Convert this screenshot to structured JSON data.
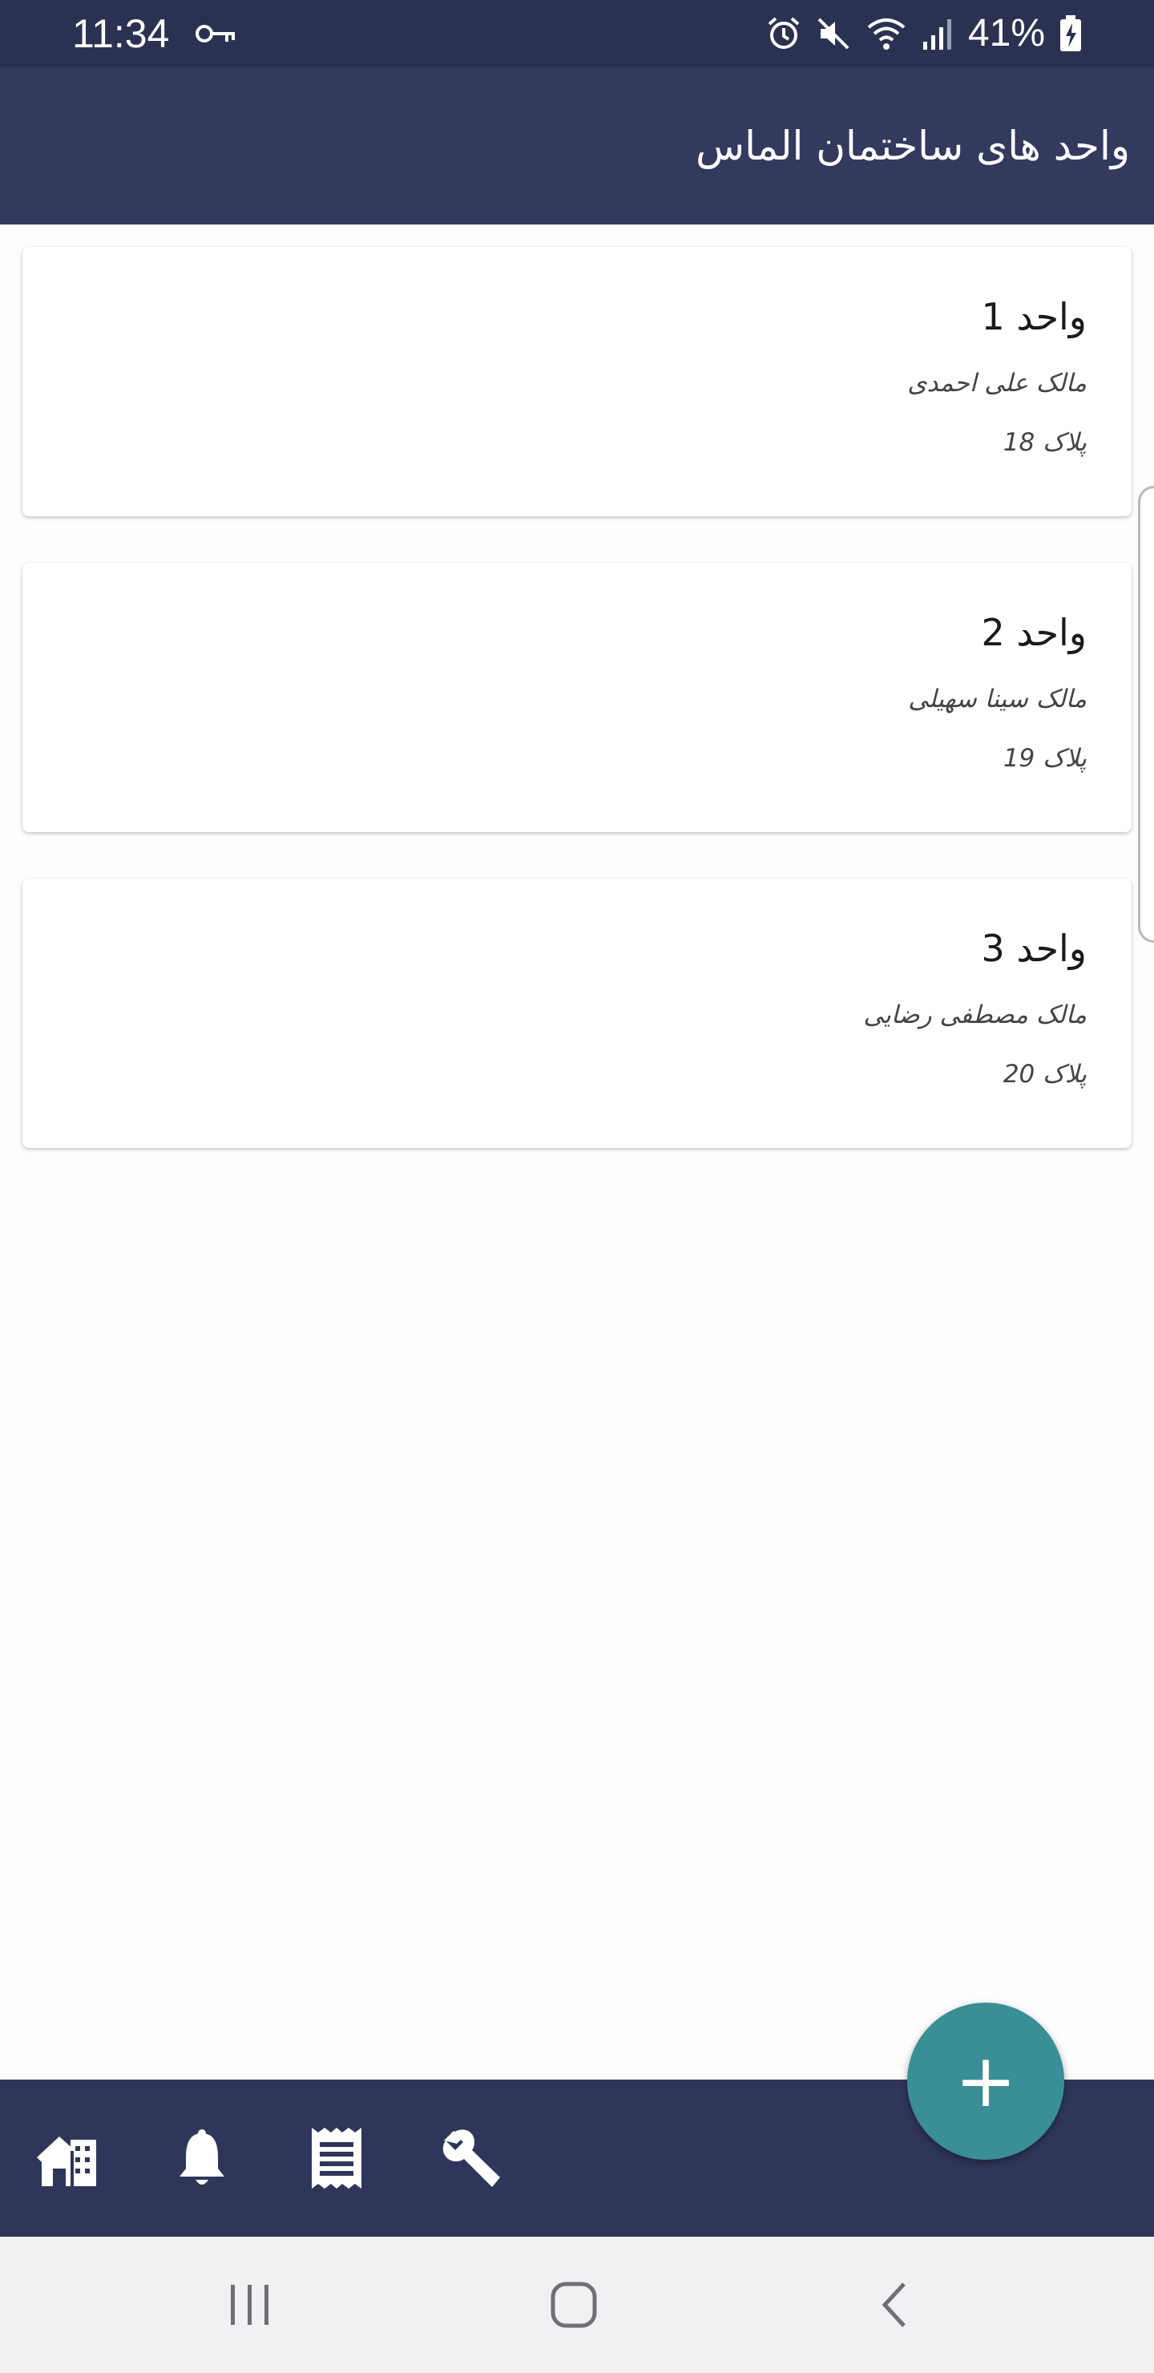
{
  "status_bar": {
    "time": "11:34",
    "battery": "41%",
    "icons": [
      "key-icon",
      "alarm-icon",
      "mute-icon",
      "wifi-icon",
      "signal-icon",
      "battery-charging-icon"
    ]
  },
  "app_bar": {
    "title": "واحد های ساختمان الماس"
  },
  "units": [
    {
      "title": "واحد 1",
      "owner": "مالک علی احمدی",
      "plate": "پلاک 18"
    },
    {
      "title": "واحد 2",
      "owner": "مالک سینا سهیلی",
      "plate": "پلاک 19"
    },
    {
      "title": "واحد 3",
      "owner": "مالک مصطفی رضایی",
      "plate": "پلاک 20"
    }
  ],
  "fab": {
    "label": "+",
    "icon": "add-icon"
  },
  "bottom_nav": {
    "items": [
      "building-icon",
      "bell-icon",
      "receipt-icon",
      "wrench-icon"
    ]
  },
  "system_nav": {
    "items": [
      "recent-apps-icon",
      "home-icon",
      "back-icon"
    ]
  },
  "colors": {
    "status_bar": "#2b3251",
    "app_bar": "#333a5e",
    "bottom_nav": "#2f365a",
    "fab": "#3a8e96",
    "background": "#fdfdfd",
    "system_nav": "#f1f1f3"
  }
}
